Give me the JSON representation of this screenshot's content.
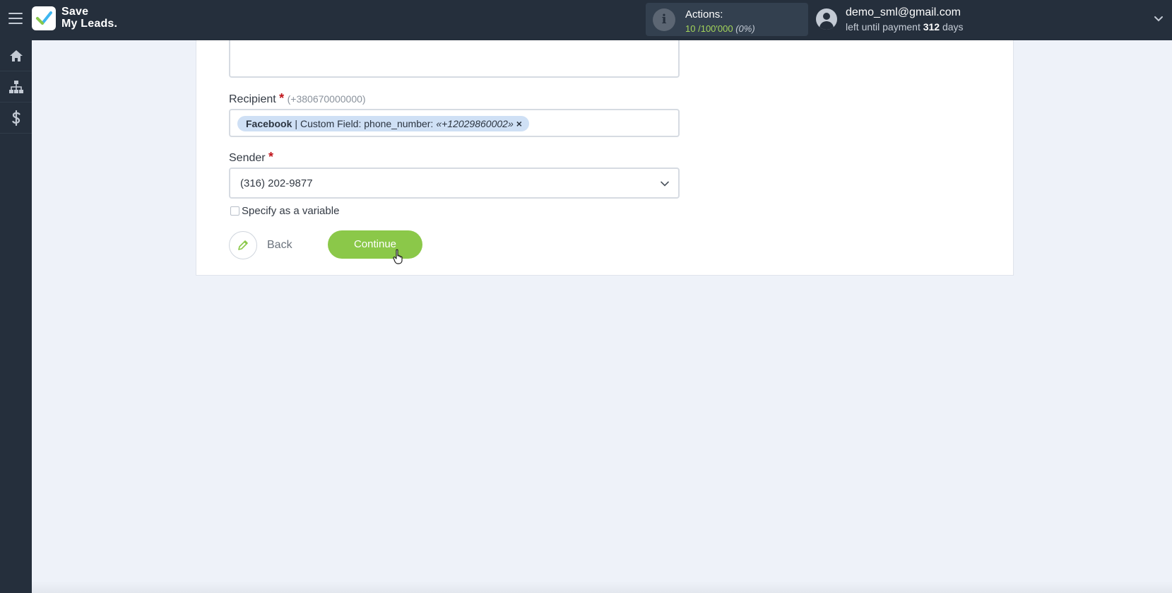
{
  "header": {
    "brand_line1": "Save",
    "brand_line2": "My Leads.",
    "actions": {
      "label": "Actions:",
      "used": "10",
      "separator": "/",
      "limit": "100'000",
      "percent": "(0%)"
    },
    "user": {
      "email": "demo_sml@gmail.com",
      "payment_prefix": "left until payment",
      "payment_days": "312",
      "payment_suffix": "days"
    }
  },
  "sidebar": {
    "items": [
      "home-icon",
      "sitemap-icon",
      "dollar-icon"
    ]
  },
  "form": {
    "recipient": {
      "label": "Recipient",
      "required_mark": "*",
      "hint": "(+380670000000)",
      "tag": {
        "source": "Facebook",
        "separator": "|",
        "field": "Custom Field: phone_number:",
        "value": "«+12029860002»",
        "remove": "×"
      }
    },
    "sender": {
      "label": "Sender",
      "required_mark": "*",
      "value": "(316) 202-9877"
    },
    "variable_checkbox": {
      "label": "Specify as a variable",
      "checked": false
    },
    "back_label": "Back",
    "continue_label": "Continue"
  },
  "colors": {
    "topbar": "#252f3c",
    "accent_green": "#8bc849",
    "tag_bg": "#cfe0f5",
    "required": "#c0151b"
  }
}
